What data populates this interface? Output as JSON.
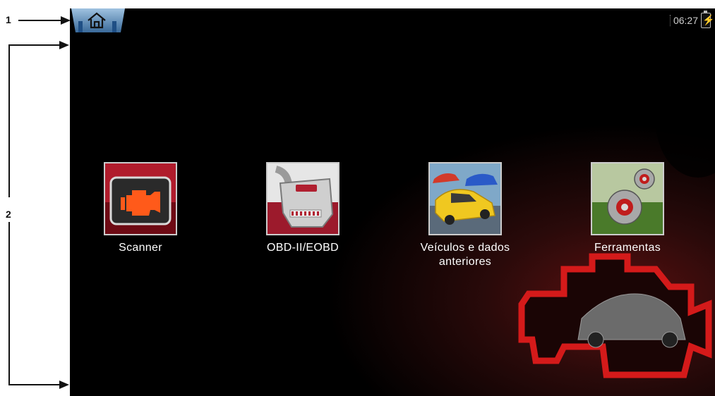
{
  "callouts": {
    "one": "1",
    "two": "2"
  },
  "status_bar": {
    "time": "06:27"
  },
  "home_button": {
    "icon": "home-icon"
  },
  "apps": [
    {
      "label": "Scanner",
      "icon": "engine-light-icon"
    },
    {
      "label": "OBD-II/EOBD",
      "icon": "obd-connector-icon"
    },
    {
      "label": "Veículos e dados anteriores",
      "icon": "cars-icon"
    },
    {
      "label": "Ferramentas",
      "icon": "gears-icon"
    }
  ],
  "colors": {
    "screen": "#000000",
    "accent": "#c41a1a",
    "label": "#ffffff"
  }
}
